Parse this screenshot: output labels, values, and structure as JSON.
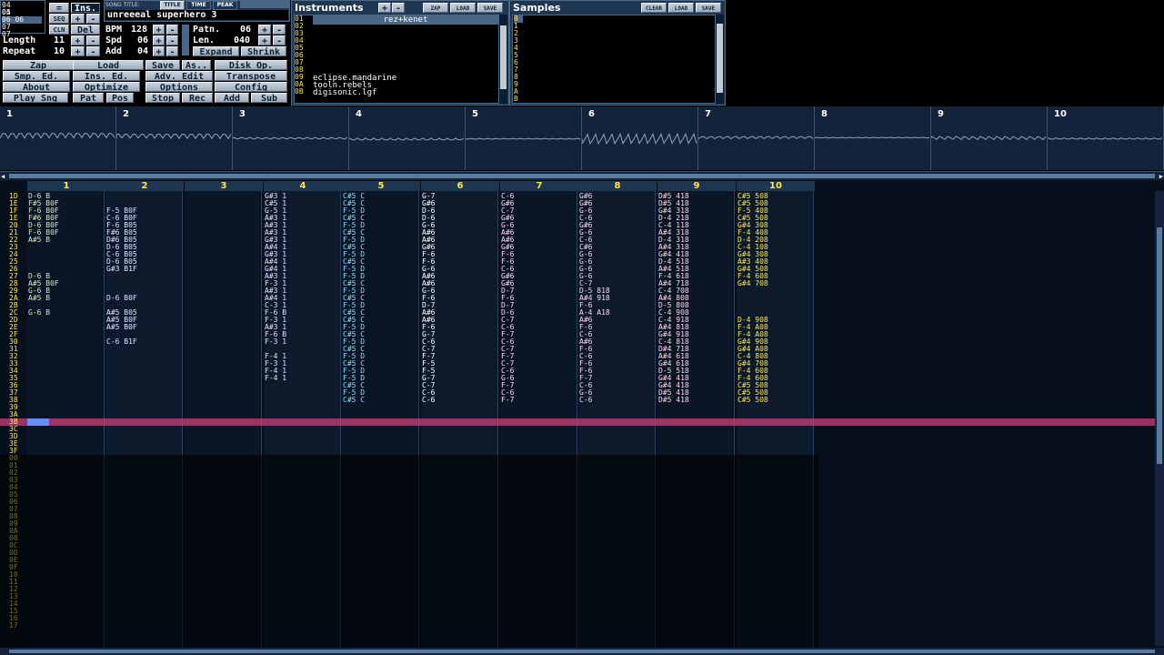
{
  "song": {
    "title_label": "SONG TITLE:",
    "title_tabs": [
      "TITLE",
      "TIME",
      "PEAK"
    ],
    "title": "unreeeal superhero 3",
    "position_rows": [
      "04 04",
      "05 05",
      "06 06",
      "07 07"
    ],
    "length_label": "Length",
    "length": "11",
    "repeat_label": "Repeat",
    "repeat": "10",
    "bpm_label": "BPM",
    "bpm": "128",
    "spd_label": "Spd",
    "spd": "06",
    "add_label": "Add",
    "add": "04",
    "patn_label": "Patn.",
    "patn": "06",
    "len_label": "Len.",
    "len": "040",
    "ins_label": "Ins.",
    "del_label": "Del",
    "seq_label": "SEQ",
    "cln_label": "CLN",
    "eq_label": "=",
    "expand": "Expand",
    "shrink": "Shrink",
    "plus": "+",
    "minus": "-"
  },
  "menu": {
    "rows": [
      [
        "Zap",
        "Load",
        "Save",
        "As..",
        "Disk Op."
      ],
      [
        "Smp. Ed.",
        "Ins. Ed.",
        "Adv. Edit",
        "Transpose"
      ],
      [
        "About",
        "Optimize",
        "Options",
        "Config"
      ],
      [
        "Play Sng",
        "Pat",
        "Pos",
        "Stop",
        "Rec",
        "Add",
        "Sub"
      ]
    ]
  },
  "instruments": {
    "title": "Instruments",
    "zap": "ZAP",
    "load": "LOAD",
    "save": "SAVE",
    "selected": "rez+kenet",
    "numbers": [
      "01",
      "02",
      "03",
      "04",
      "05",
      "06",
      "07",
      "08",
      "09",
      "0A",
      "0B"
    ],
    "names": [
      "rez+kenet",
      "",
      "",
      "",
      "",
      "",
      "",
      "",
      "eclipse.mandarine",
      "tooln.rebels",
      "digisonic.lgf"
    ]
  },
  "samples": {
    "title": "Samples",
    "clear": "CLEAR",
    "load": "LOAD",
    "save": "SAVE",
    "numbers": [
      "0",
      "1",
      "2",
      "3",
      "4",
      "5",
      "6",
      "7",
      "8",
      "9",
      "A",
      "B"
    ]
  },
  "scopes": [
    "1",
    "2",
    "3",
    "4",
    "5",
    "6",
    "7",
    "8",
    "9",
    "10"
  ],
  "channels": [
    "1",
    "2",
    "3",
    "4",
    "5",
    "6",
    "7",
    "8",
    "9",
    "10"
  ],
  "rows": [
    "1D",
    "1E",
    "1F",
    "1E",
    "20",
    "21",
    "22",
    "23",
    "24",
    "25",
    "26",
    "27",
    "28",
    "29",
    "2A",
    "2B",
    "2C",
    "2D",
    "2E",
    "2F",
    "30",
    "31",
    "32",
    "33",
    "34",
    "35",
    "36",
    "37",
    "38",
    "39",
    "3A",
    "3B",
    "3C",
    "3D",
    "3E",
    "3F",
    "00",
    "01",
    "02",
    "03",
    "04",
    "05",
    "06",
    "07",
    "08",
    "09",
    "0A",
    "0B",
    "0C",
    "0D",
    "0E",
    "0F",
    "10",
    "11",
    "12",
    "13",
    "14",
    "15",
    "16",
    "17"
  ],
  "cursor_row": "3B",
  "pattern": [
    [
      "D-6 B",
      "",
      "G#3 1",
      "C#5 C",
      "G-7",
      "C-6",
      "G#6",
      "D#5 418",
      "C#5 508"
    ],
    [
      "F#5 B0F",
      "",
      "C#5 1",
      "C#5 C",
      "G#6",
      "G#6",
      "G#6",
      "D#5 418",
      "C#5 508"
    ],
    [
      "F-6 B0F",
      "F-5 B0F",
      "G-5 1",
      "F-5 D",
      "D-6",
      "C-7",
      "G-6",
      "G#4 318",
      "F-5 408"
    ],
    [
      "F#6 B0F",
      "C-6 B0F",
      "A#3 1",
      "C#5 C",
      "D-6",
      "G#6",
      "C-6",
      "D-4 218",
      "C#5 508"
    ],
    [
      "D-6 B0F",
      "F-6 B05",
      "A#3 1",
      "F-5 D",
      "G-6",
      "G-6",
      "G#6",
      "C-4 118",
      "G#4 308"
    ],
    [
      "F-6 B0F",
      "F#6 B05",
      "A#3 1",
      "C#5 C",
      "A#6",
      "A#6",
      "G-6",
      "A#4 318",
      "F-4 408"
    ],
    [
      "A#5 B",
      "D#6 B05",
      "G#3 1",
      "F-5 D",
      "A#6",
      "A#6",
      "C-6",
      "D-4 318",
      "D-4 208"
    ],
    [
      "",
      "D-6 B05",
      "A#4 1",
      "C#5 C",
      "G#6",
      "G#6",
      "C#6",
      "A#4 318",
      "C-4 108"
    ],
    [
      "",
      "C-6 B05",
      "G#3 1",
      "F-5 D",
      "F-6",
      "F-6",
      "G-6",
      "G#4 418",
      "G#4 308"
    ],
    [
      "",
      "D-6 B05",
      "A#4 1",
      "C#5 C",
      "F-6",
      "F-6",
      "G-6",
      "D-4 518",
      "A#3 408"
    ],
    [
      "",
      "G#3 B1F",
      "G#4 1",
      "F-5 D",
      "G-6",
      "C-6",
      "G-6",
      "A#4 518",
      "G#4 508"
    ],
    [
      "D-6 B",
      "",
      "A#3 1",
      "F-5 D",
      "A#6",
      "G#6",
      "G-6",
      "F-4 618",
      "F-4 608"
    ],
    [
      "A#5 B0F",
      "",
      "F-3 1",
      "C#5 C",
      "A#6",
      "G#6",
      "C-7",
      "A#4 718",
      "G#4 708"
    ],
    [
      "G-6 B",
      "",
      "A#3 1",
      "F-5 D",
      "G-6",
      "D-7",
      "D-5 818",
      "C-4 708"
    ],
    [
      "A#5 B",
      "D-6 B0F",
      "A#4 1",
      "C#5 C",
      "F-6",
      "F-6",
      "A#4 918",
      "A#4 808"
    ],
    [
      "",
      "",
      "C-3 1",
      "F-5 D",
      "D-7",
      "D-7",
      "F-6",
      "D-5 808"
    ],
    [
      "G-6 B",
      "A#5 B05",
      "F-6 B",
      "C#5 C",
      "A#6",
      "D-6",
      "A-4 A18",
      "C-4 908"
    ],
    [
      "",
      "A#5 B0F",
      "F-3 1",
      "C#5 C",
      "A#6",
      "C-7",
      "A#6",
      "C-4 918",
      "D-4 908"
    ],
    [
      "",
      "A#5 B0F",
      "A#3 1",
      "F-5 D",
      "F-6",
      "C-6",
      "F-6",
      "A#4 818",
      "F-4 A08"
    ],
    [
      "",
      "",
      "F-6 B",
      "C#5 C",
      "G-7",
      "F-7",
      "C-6",
      "G#4 918",
      "F-4 A08"
    ],
    [
      "",
      "C-6 B1F",
      "F-3 1",
      "F-5 D",
      "C-6",
      "C-6",
      "A#6",
      "C-4 818",
      "G#4 908"
    ],
    [
      "",
      "",
      "",
      "C#5 C",
      "C-7",
      "C-7",
      "F-6",
      "D#4 718",
      "G#4 A08"
    ],
    [
      "",
      "",
      "F-4 1",
      "F-5 D",
      "F-7",
      "F-7",
      "C-6",
      "A#4 618",
      "C-4 808"
    ],
    [
      "",
      "",
      "F-3 1",
      "C#5 C",
      "F-5",
      "C-7",
      "F-6",
      "G#4 618",
      "G#4 708"
    ],
    [
      "",
      "",
      "F-4 1",
      "F-5 D",
      "F-5",
      "C-6",
      "F-6",
      "D-5 518",
      "F-4 608"
    ],
    [
      "",
      "",
      "F-4 1",
      "F-5 D",
      "G-7",
      "G-6",
      "F-7",
      "G#4 418",
      "F-4 608"
    ],
    [
      "",
      "",
      "",
      "C#5 C",
      "C-7",
      "F-7",
      "C-6",
      "G#4 418",
      "C#5 508"
    ],
    [
      "",
      "",
      "",
      "F-5 D",
      "C-6",
      "C-6",
      "G-6",
      "D#5 418",
      "C#5 508"
    ],
    [
      "",
      "",
      "",
      "C#5 C",
      "C-6",
      "F-7",
      "C-6",
      "D#5 418",
      "C#5 508"
    ]
  ],
  "colors": {
    "accent": "#ffe84a",
    "panel": "#1e3650",
    "cursor": "#d23c7a",
    "note_col4": "#7ee0ff",
    "note_col5": "#ffffff"
  }
}
